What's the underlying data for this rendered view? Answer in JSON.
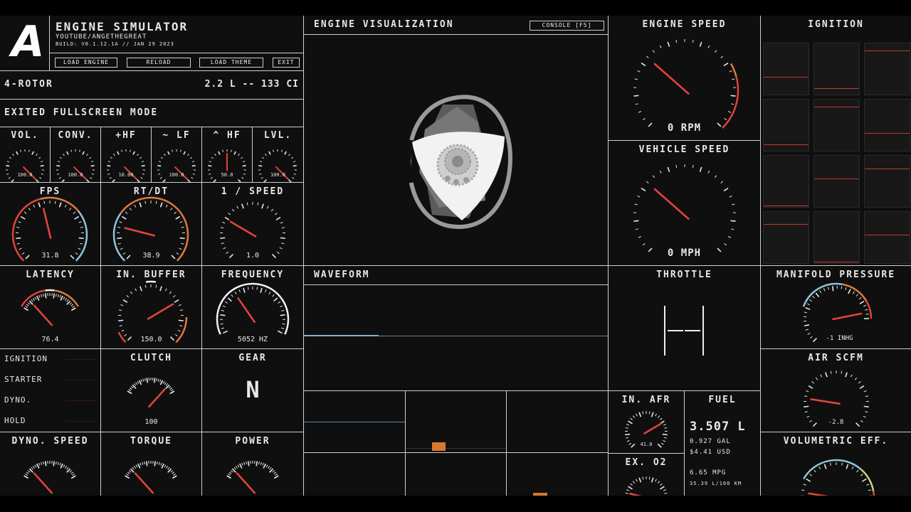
{
  "header": {
    "logo": "A",
    "app_title": "ENGINE SIMULATOR",
    "subtitle": "YOUTUBE/ANGETHEGREAT",
    "build": "BUILD: V0.1.12.1A // JAN 29 2023",
    "buttons": {
      "load_engine": "LOAD ENGINE",
      "reload": "RELOAD",
      "load_theme": "LOAD THEME",
      "exit": "EXIT"
    }
  },
  "engine_info": {
    "name": "4-ROTOR",
    "displacement": "2.2 L -- 133 CI"
  },
  "status_message": "EXITED FULLSCREEN MODE",
  "small_gauges": [
    {
      "label": "VOL.",
      "value": "100.0"
    },
    {
      "label": "CONV.",
      "value": "100.0"
    },
    {
      "label": "+HF",
      "value": "10.00"
    },
    {
      "label": "~ LF",
      "value": "100.0"
    },
    {
      "label": "^ HF",
      "value": "50.0"
    },
    {
      "label": "LVL.",
      "value": "100.0"
    }
  ],
  "perf_gauges": {
    "fps": {
      "label": "FPS",
      "value": "31.8"
    },
    "rtdt": {
      "label": "RT/DT",
      "value": "38.9"
    },
    "speed": {
      "label": "1 / SPEED",
      "value": "1.0"
    },
    "latency": {
      "label": "LATENCY",
      "value": "76.4"
    },
    "in_buffer": {
      "label": "IN. BUFFER",
      "value": "150.0"
    },
    "frequency": {
      "label": "FREQUENCY",
      "value": "5052 HZ"
    }
  },
  "controls": {
    "rows": [
      "IGNITION",
      "STARTER",
      "DYNO.",
      "HOLD"
    ],
    "clutch": {
      "label": "CLUTCH",
      "value": "100"
    },
    "gear": {
      "label": "GEAR",
      "value": "N"
    }
  },
  "bottom_gauges": {
    "dyno_speed": "DYNO. SPEED",
    "torque": "TORQUE",
    "power": "POWER"
  },
  "visualization": {
    "title": "ENGINE VISUALIZATION",
    "console_button": "CONSOLE [F5]"
  },
  "waveform": {
    "title": "WAVEFORM"
  },
  "engine_speed": {
    "title": "ENGINE SPEED",
    "value": "0 RPM"
  },
  "vehicle_speed": {
    "title": "VEHICLE SPEED",
    "value": "0 MPH"
  },
  "throttle": {
    "title": "THROTTLE"
  },
  "afr": {
    "title": "IN. AFR",
    "value": "41.0"
  },
  "ex_o2": {
    "title": "EX. O2"
  },
  "fuel": {
    "title": "FUEL",
    "liters": "3.507 L",
    "gallons": "0.927 GAL",
    "cost": "$4.41 USD",
    "mpg": "6.65 MPG",
    "l_per_100": "35.39 L/100 KM"
  },
  "ignition_panel": {
    "title": "IGNITION"
  },
  "manifold": {
    "title": "MANIFOLD PRESSURE",
    "value": "-1 INHG"
  },
  "air_scfm": {
    "title": "AIR SCFM",
    "value": "-2.8"
  },
  "vol_eff": {
    "title": "VOLUMETRIC EFF."
  },
  "colors": {
    "accent_red": "#e0443a",
    "accent_orange": "#e07a3a",
    "accent_blue": "#8fc4dc",
    "bg": "#0f0f10"
  }
}
